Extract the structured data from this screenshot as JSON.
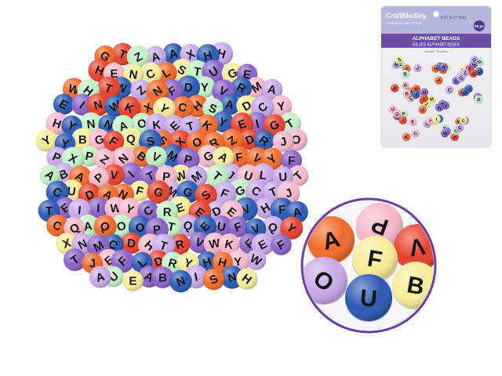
{
  "package": {
    "brand": "CraftMedley",
    "tagline": "A CREATIVE WAY TO PLAY",
    "size_text": "0.27 in (7 mm)",
    "count_badge": "90 pc",
    "title_en": "ALPHABET BEADS",
    "title_fr": "BILLES ALPHABÉTIQUES",
    "shape_text": "Round / Rondes",
    "colors": {
      "header": "#b7b6dc",
      "title_band": "#6c4ea7",
      "badge": "#4e3a8f",
      "brand": "#ffffff"
    }
  },
  "closeup": {
    "ring_color": "#6a3ea2",
    "letters": [
      "A",
      "P",
      "V",
      "O",
      "F",
      "U",
      "B"
    ]
  },
  "bead_colors": {
    "purple": "#8a62c8",
    "pink": "#f7b7c9",
    "yellow": "#f7ec96",
    "orange": "#f26a2a",
    "red": "#e8422c",
    "blue": "#2b5ab5",
    "mint": "#bff0c3",
    "lilac": "#c8a8e8"
  }
}
